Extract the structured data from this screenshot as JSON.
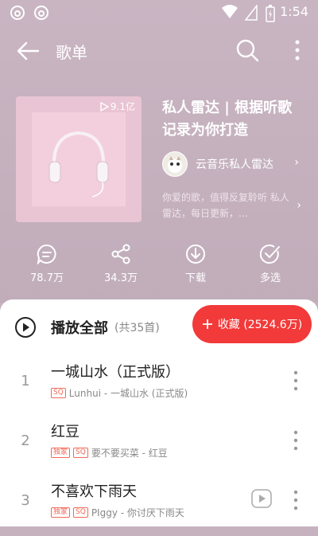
{
  "status": {
    "time": "1:54"
  },
  "nav": {
    "title": "歌单"
  },
  "playlist": {
    "play_count": "9.1亿",
    "title": "私人雷达 | 根据听歌记录为你打造",
    "creator": "云音乐私人雷达",
    "description": "你爱的歌，值得反复聆听 私人雷达，每日更新，..."
  },
  "actions": {
    "comments": "78.7万",
    "share": "34.3万",
    "download": "下载",
    "multi": "多选"
  },
  "list": {
    "play_all": "播放全部",
    "count": "(共35首)",
    "collect_label": "收藏 (2524.6万)"
  },
  "songs": [
    {
      "index": "1",
      "name": "一城山水（正式版）",
      "badges": [
        "SQ"
      ],
      "subtitle": "Lunhui - 一城山水 (正式版)"
    },
    {
      "index": "2",
      "name": "红豆",
      "badges": [
        "独家",
        "SQ"
      ],
      "subtitle": "要不要买菜 - 红豆"
    },
    {
      "index": "3",
      "name": "不喜欢下雨天",
      "badges": [
        "独家",
        "SQ"
      ],
      "subtitle": "PIggy - 你讨厌下雨天"
    }
  ],
  "colors": {
    "accent": "#f23a3a",
    "header_bg": "#c6b2bf"
  },
  "icons": [
    "app-logo-icon",
    "wifi-icon",
    "sim-icon",
    "battery-icon",
    "back-arrow-icon",
    "search-icon",
    "more-vertical-icon",
    "play-count-icon",
    "comment-icon",
    "share-icon",
    "download-icon",
    "multiselect-icon",
    "play-circle-icon",
    "plus-icon",
    "mv-icon"
  ]
}
